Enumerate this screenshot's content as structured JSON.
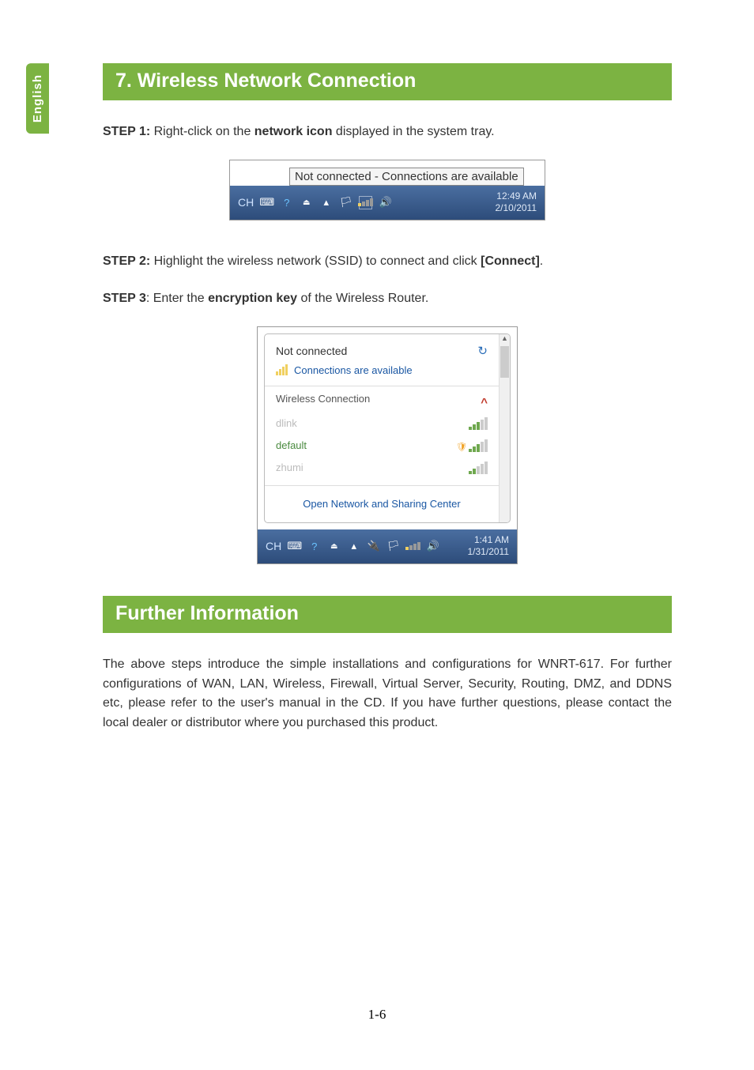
{
  "language_tab": "English",
  "section1": {
    "heading": "7. Wireless Network Connection",
    "step1_prefix": "STEP 1:",
    "step1_text_part1": " Right-click on the ",
    "step1_bold": "network icon",
    "step1_text_part2": " displayed in the system tray.",
    "step2_prefix": "STEP 2:",
    "step2_text_part1": " Highlight the wireless network (SSID) to connect and click ",
    "step2_bold": "[Connect]",
    "step2_text_part2": ".",
    "step3_prefix": "STEP 3",
    "step3_text_part1": ": Enter the ",
    "step3_bold": "encryption key",
    "step3_text_part2": " of the Wireless Router."
  },
  "screenshot1": {
    "tooltip": "Not connected - Connections are available",
    "ch_label": "CH",
    "time": "12:49 AM",
    "date": "2/10/2011"
  },
  "screenshot2": {
    "header": "Not connected",
    "sub": "Connections are available",
    "list_title": "Wireless Connection",
    "networks": {
      "n0": "dlink",
      "n1": "default",
      "n2": "zhumi"
    },
    "footer_link": "Open Network and Sharing Center",
    "ch_label": "CH",
    "time": "1:41 AM",
    "date": "1/31/2011"
  },
  "section2": {
    "heading": "Further Information",
    "paragraph": "The above steps introduce the simple installations and configurations for WNRT-617. For further configurations of WAN, LAN, Wireless, Firewall, Virtual Server, Security, Routing, DMZ, and DDNS etc, please refer to the user's manual in the CD. If you have further questions, please contact the local dealer or distributor where you purchased this product."
  },
  "page_number": "1-6"
}
